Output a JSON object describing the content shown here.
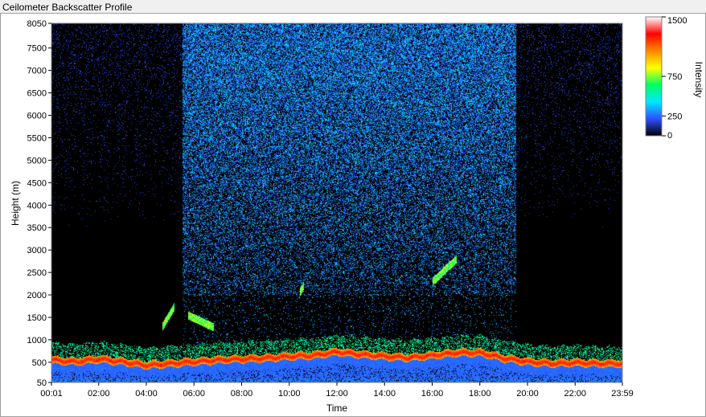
{
  "window_title": "Ceilometer Backscatter Profile",
  "chart_data": {
    "type": "heatmap",
    "title": "",
    "xlabel": "Time",
    "ylabel": "Height (m)",
    "x_ticks": [
      "00:01",
      "02:00",
      "04:00",
      "06:00",
      "08:00",
      "10:00",
      "12:00",
      "14:00",
      "16:00",
      "18:00",
      "20:00",
      "22:00",
      "23:59"
    ],
    "y_ticks": [
      50,
      500,
      1000,
      1500,
      2000,
      2500,
      3000,
      3500,
      4000,
      4500,
      5000,
      5500,
      6000,
      6500,
      7000,
      7500,
      8050
    ],
    "xlim": [
      "00:01",
      "23:59"
    ],
    "ylim": [
      50,
      8050
    ],
    "colorbar": {
      "label": "Intensity",
      "ticks": [
        0,
        250,
        750,
        1500
      ],
      "range": [
        0,
        1500
      ],
      "colors": [
        "#000000",
        "#3050ff",
        "#00e8ff",
        "#00ff60",
        "#ffff00",
        "#ff8800",
        "#ff0000",
        "#ffffff"
      ]
    },
    "features": {
      "boundary_layer_height_m": [
        [
          0,
          600
        ],
        [
          1,
          560
        ],
        [
          2,
          620
        ],
        [
          3,
          560
        ],
        [
          4,
          480
        ],
        [
          5,
          520
        ],
        [
          6,
          560
        ],
        [
          7,
          600
        ],
        [
          8,
          620
        ],
        [
          9,
          640
        ],
        [
          10,
          680
        ],
        [
          11,
          700
        ],
        [
          12,
          780
        ],
        [
          13,
          720
        ],
        [
          14,
          680
        ],
        [
          15,
          650
        ],
        [
          16,
          700
        ],
        [
          17,
          760
        ],
        [
          18,
          760
        ],
        [
          19,
          640
        ],
        [
          20,
          560
        ],
        [
          21,
          520
        ],
        [
          22,
          540
        ],
        [
          23,
          520
        ],
        [
          23.98,
          520
        ]
      ],
      "cloud_layers": [
        {
          "time_start": "05:45",
          "time_end": "06:50",
          "height_start": 1550,
          "height_end": 1280
        },
        {
          "time_start": "16:00",
          "time_end": "17:00",
          "height_start": 2300,
          "height_end": 2800
        },
        {
          "time_start": "04:40",
          "time_end": "05:10",
          "height_start": 1300,
          "height_end": 1750
        },
        {
          "time_start": "10:25",
          "time_end": "10:35",
          "height_start": 2050,
          "height_end": 2200
        }
      ],
      "aerosol_noise_region": {
        "time_start": "05:30",
        "time_end": "19:30"
      }
    }
  }
}
